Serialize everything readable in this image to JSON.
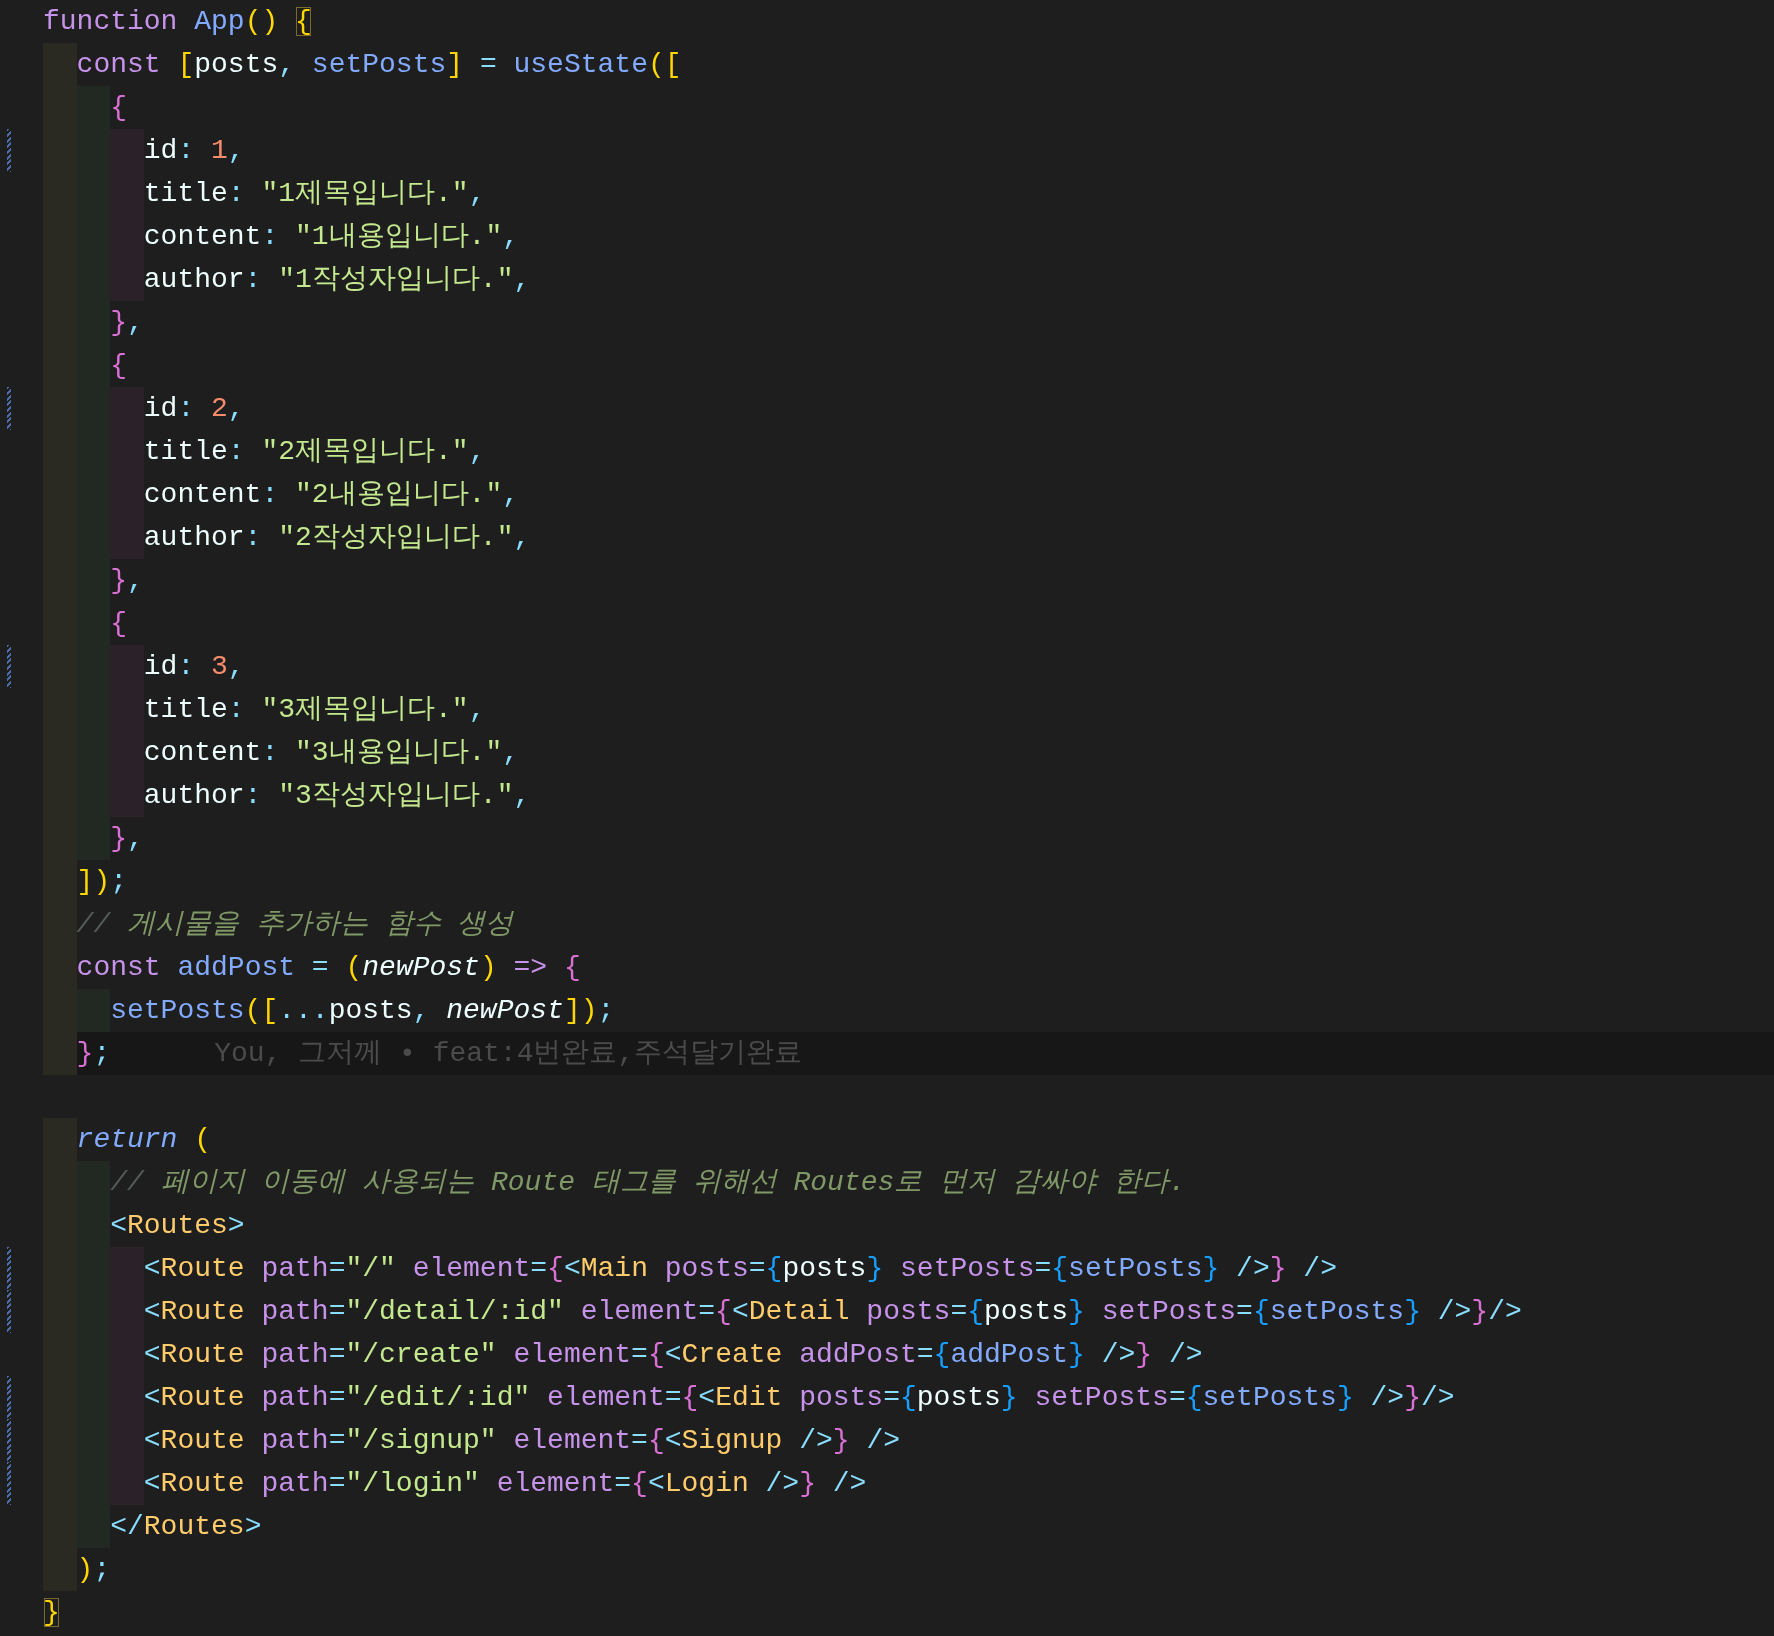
{
  "editor": {
    "lines": [
      {
        "modified": false,
        "current": false,
        "tokens": [
          {
            "text": "function ",
            "kind": "keyword"
          },
          {
            "text": "App",
            "kind": "function"
          },
          {
            "text": "() ",
            "kind": "bracket1"
          },
          {
            "text": "{",
            "kind": "bracket1-match"
          }
        ],
        "children": [
          {
            "modified": false,
            "current": false,
            "tokens": [
              {
                "text": "const ",
                "kind": "keyword"
              },
              {
                "text": "[",
                "kind": "bracket1"
              },
              {
                "text": "posts",
                "kind": "plain"
              },
              {
                "text": ", ",
                "kind": "punct"
              },
              {
                "text": "setPosts",
                "kind": "function"
              },
              {
                "text": "]",
                "kind": "bracket1"
              },
              {
                "text": " = ",
                "kind": "punct"
              },
              {
                "text": "useState",
                "kind": "function"
              },
              {
                "text": "([",
                "kind": "bracket1"
              }
            ],
            "children": [
              {
                "modified": false,
                "current": false,
                "tokens": [
                  {
                    "text": "{",
                    "kind": "bracket2"
                  }
                ],
                "children": [
                  {
                    "modified": true,
                    "current": false,
                    "tokens": [
                      {
                        "text": "id",
                        "kind": "plain"
                      },
                      {
                        "text": ": ",
                        "kind": "punct"
                      },
                      {
                        "text": "1",
                        "kind": "number"
                      },
                      {
                        "text": ",",
                        "kind": "punct"
                      }
                    ]
                  },
                  {
                    "modified": false,
                    "current": false,
                    "tokens": [
                      {
                        "text": "title",
                        "kind": "plain"
                      },
                      {
                        "text": ": ",
                        "kind": "punct"
                      },
                      {
                        "text": "\"1제목입니다.\"",
                        "kind": "string"
                      },
                      {
                        "text": ",",
                        "kind": "punct"
                      }
                    ]
                  },
                  {
                    "modified": false,
                    "current": false,
                    "tokens": [
                      {
                        "text": "content",
                        "kind": "plain"
                      },
                      {
                        "text": ": ",
                        "kind": "punct"
                      },
                      {
                        "text": "\"1내용입니다.\"",
                        "kind": "string"
                      },
                      {
                        "text": ",",
                        "kind": "punct"
                      }
                    ]
                  },
                  {
                    "modified": false,
                    "current": false,
                    "tokens": [
                      {
                        "text": "author",
                        "kind": "plain"
                      },
                      {
                        "text": ": ",
                        "kind": "punct"
                      },
                      {
                        "text": "\"1작성자입니다.\"",
                        "kind": "string"
                      },
                      {
                        "text": ",",
                        "kind": "punct"
                      }
                    ]
                  }
                ]
              },
              {
                "modified": false,
                "current": false,
                "tokens": [
                  {
                    "text": "}",
                    "kind": "bracket2"
                  },
                  {
                    "text": ",",
                    "kind": "punct"
                  }
                ]
              },
              {
                "modified": false,
                "current": false,
                "tokens": [
                  {
                    "text": "{",
                    "kind": "bracket2"
                  }
                ],
                "children": [
                  {
                    "modified": true,
                    "current": false,
                    "tokens": [
                      {
                        "text": "id",
                        "kind": "plain"
                      },
                      {
                        "text": ": ",
                        "kind": "punct"
                      },
                      {
                        "text": "2",
                        "kind": "number"
                      },
                      {
                        "text": ",",
                        "kind": "punct"
                      }
                    ]
                  },
                  {
                    "modified": false,
                    "current": false,
                    "tokens": [
                      {
                        "text": "title",
                        "kind": "plain"
                      },
                      {
                        "text": ": ",
                        "kind": "punct"
                      },
                      {
                        "text": "\"2제목입니다.\"",
                        "kind": "string"
                      },
                      {
                        "text": ",",
                        "kind": "punct"
                      }
                    ]
                  },
                  {
                    "modified": false,
                    "current": false,
                    "tokens": [
                      {
                        "text": "content",
                        "kind": "plain"
                      },
                      {
                        "text": ": ",
                        "kind": "punct"
                      },
                      {
                        "text": "\"2내용입니다.\"",
                        "kind": "string"
                      },
                      {
                        "text": ",",
                        "kind": "punct"
                      }
                    ]
                  },
                  {
                    "modified": false,
                    "current": false,
                    "tokens": [
                      {
                        "text": "author",
                        "kind": "plain"
                      },
                      {
                        "text": ": ",
                        "kind": "punct"
                      },
                      {
                        "text": "\"2작성자입니다.\"",
                        "kind": "string"
                      },
                      {
                        "text": ",",
                        "kind": "punct"
                      }
                    ]
                  }
                ]
              },
              {
                "modified": false,
                "current": false,
                "tokens": [
                  {
                    "text": "}",
                    "kind": "bracket2"
                  },
                  {
                    "text": ",",
                    "kind": "punct"
                  }
                ]
              },
              {
                "modified": false,
                "current": false,
                "tokens": [
                  {
                    "text": "{",
                    "kind": "bracket2"
                  }
                ],
                "children": [
                  {
                    "modified": true,
                    "current": false,
                    "tokens": [
                      {
                        "text": "id",
                        "kind": "plain"
                      },
                      {
                        "text": ": ",
                        "kind": "punct"
                      },
                      {
                        "text": "3",
                        "kind": "number"
                      },
                      {
                        "text": ",",
                        "kind": "punct"
                      }
                    ]
                  },
                  {
                    "modified": false,
                    "current": false,
                    "tokens": [
                      {
                        "text": "title",
                        "kind": "plain"
                      },
                      {
                        "text": ": ",
                        "kind": "punct"
                      },
                      {
                        "text": "\"3제목입니다.\"",
                        "kind": "string"
                      },
                      {
                        "text": ",",
                        "kind": "punct"
                      }
                    ]
                  },
                  {
                    "modified": false,
                    "current": false,
                    "tokens": [
                      {
                        "text": "content",
                        "kind": "plain"
                      },
                      {
                        "text": ": ",
                        "kind": "punct"
                      },
                      {
                        "text": "\"3내용입니다.\"",
                        "kind": "string"
                      },
                      {
                        "text": ",",
                        "kind": "punct"
                      }
                    ]
                  },
                  {
                    "modified": false,
                    "current": false,
                    "tokens": [
                      {
                        "text": "author",
                        "kind": "plain"
                      },
                      {
                        "text": ": ",
                        "kind": "punct"
                      },
                      {
                        "text": "\"3작성자입니다.\"",
                        "kind": "string"
                      },
                      {
                        "text": ",",
                        "kind": "punct"
                      }
                    ]
                  }
                ]
              },
              {
                "modified": false,
                "current": false,
                "tokens": [
                  {
                    "text": "}",
                    "kind": "bracket2"
                  },
                  {
                    "text": ",",
                    "kind": "punct"
                  }
                ]
              }
            ]
          },
          {
            "modified": false,
            "current": false,
            "tokens": [
              {
                "text": "])",
                "kind": "bracket1"
              },
              {
                "text": ";",
                "kind": "punct"
              }
            ]
          },
          {
            "modified": false,
            "current": false,
            "tokens": [
              {
                "text": "// ",
                "kind": "comment-mark"
              },
              {
                "text": "게시물을 추가하는 함수 생성",
                "kind": "comment"
              }
            ]
          },
          {
            "modified": false,
            "current": false,
            "tokens": [
              {
                "text": "const ",
                "kind": "keyword"
              },
              {
                "text": "addPost",
                "kind": "function"
              },
              {
                "text": " = ",
                "kind": "punct"
              },
              {
                "text": "(",
                "kind": "bracket1"
              },
              {
                "text": "newPost",
                "kind": "param"
              },
              {
                "text": ")",
                "kind": "bracket1"
              },
              {
                "text": " => ",
                "kind": "keyword"
              },
              {
                "text": "{",
                "kind": "bracket2"
              }
            ],
            "children": [
              {
                "modified": false,
                "current": false,
                "tokens": [
                  {
                    "text": "setPosts",
                    "kind": "function"
                  },
                  {
                    "text": "([",
                    "kind": "bracket1"
                  },
                  {
                    "text": "...",
                    "kind": "punct"
                  },
                  {
                    "text": "posts",
                    "kind": "plain"
                  },
                  {
                    "text": ", ",
                    "kind": "punct"
                  },
                  {
                    "text": "newPost",
                    "kind": "param"
                  },
                  {
                    "text": "])",
                    "kind": "bracket1"
                  },
                  {
                    "text": ";",
                    "kind": "punct"
                  }
                ]
              }
            ]
          },
          {
            "modified": false,
            "current": true,
            "tokens": [
              {
                "text": "}",
                "kind": "bracket2"
              },
              {
                "text": ";",
                "kind": "punct"
              }
            ],
            "blame": "You, 그저께 • feat:4번완료,주석달기완료"
          },
          {
            "modified": false,
            "current": false
          },
          {
            "modified": false,
            "current": false,
            "tokens": [
              {
                "text": "return ",
                "kind": "return"
              },
              {
                "text": "(",
                "kind": "bracket1"
              }
            ],
            "children": [
              {
                "modified": false,
                "current": false,
                "tokens": [
                  {
                    "text": "// ",
                    "kind": "comment-mark"
                  },
                  {
                    "text": "페이지 이동에 사용되는 Route 태그를 위해선 Routes로 먼저 감싸야 한다.",
                    "kind": "comment"
                  }
                ]
              },
              {
                "modified": false,
                "current": false,
                "tokens": [
                  {
                    "text": "<",
                    "kind": "punct"
                  },
                  {
                    "text": "Routes",
                    "kind": "tag"
                  },
                  {
                    "text": ">",
                    "kind": "punct"
                  }
                ],
                "children": [
                  {
                    "modified": true,
                    "current": false,
                    "tokens": [
                      {
                        "text": "<",
                        "kind": "punct"
                      },
                      {
                        "text": "Route",
                        "kind": "tag"
                      },
                      {
                        "text": " path",
                        "kind": "attribute"
                      },
                      {
                        "text": "=",
                        "kind": "punct"
                      },
                      {
                        "text": "\"/\"",
                        "kind": "string"
                      },
                      {
                        "text": " element",
                        "kind": "attribute"
                      },
                      {
                        "text": "=",
                        "kind": "punct"
                      },
                      {
                        "text": "{",
                        "kind": "bracket2"
                      },
                      {
                        "text": "<",
                        "kind": "punct"
                      },
                      {
                        "text": "Main",
                        "kind": "tag"
                      },
                      {
                        "text": " posts",
                        "kind": "attribute"
                      },
                      {
                        "text": "=",
                        "kind": "punct"
                      },
                      {
                        "text": "{",
                        "kind": "bracket3"
                      },
                      {
                        "text": "posts",
                        "kind": "plain"
                      },
                      {
                        "text": "}",
                        "kind": "bracket3"
                      },
                      {
                        "text": " setPosts",
                        "kind": "attribute"
                      },
                      {
                        "text": "=",
                        "kind": "punct"
                      },
                      {
                        "text": "{",
                        "kind": "bracket3"
                      },
                      {
                        "text": "setPosts",
                        "kind": "function"
                      },
                      {
                        "text": "}",
                        "kind": "bracket3"
                      },
                      {
                        "text": " />",
                        "kind": "punct"
                      },
                      {
                        "text": "}",
                        "kind": "bracket2"
                      },
                      {
                        "text": " />",
                        "kind": "punct"
                      }
                    ]
                  },
                  {
                    "modified": true,
                    "current": false,
                    "tokens": [
                      {
                        "text": "<",
                        "kind": "punct"
                      },
                      {
                        "text": "Route",
                        "kind": "tag"
                      },
                      {
                        "text": " path",
                        "kind": "attribute"
                      },
                      {
                        "text": "=",
                        "kind": "punct"
                      },
                      {
                        "text": "\"/detail/:id\"",
                        "kind": "string"
                      },
                      {
                        "text": " element",
                        "kind": "attribute"
                      },
                      {
                        "text": "=",
                        "kind": "punct"
                      },
                      {
                        "text": "{",
                        "kind": "bracket2"
                      },
                      {
                        "text": "<",
                        "kind": "punct"
                      },
                      {
                        "text": "Detail",
                        "kind": "tag"
                      },
                      {
                        "text": " posts",
                        "kind": "attribute"
                      },
                      {
                        "text": "=",
                        "kind": "punct"
                      },
                      {
                        "text": "{",
                        "kind": "bracket3"
                      },
                      {
                        "text": "posts",
                        "kind": "plain"
                      },
                      {
                        "text": "}",
                        "kind": "bracket3"
                      },
                      {
                        "text": " setPosts",
                        "kind": "attribute"
                      },
                      {
                        "text": "=",
                        "kind": "punct"
                      },
                      {
                        "text": "{",
                        "kind": "bracket3"
                      },
                      {
                        "text": "setPosts",
                        "kind": "function"
                      },
                      {
                        "text": "}",
                        "kind": "bracket3"
                      },
                      {
                        "text": " />",
                        "kind": "punct"
                      },
                      {
                        "text": "}",
                        "kind": "bracket2"
                      },
                      {
                        "text": "/>",
                        "kind": "punct"
                      }
                    ]
                  },
                  {
                    "modified": false,
                    "current": false,
                    "tokens": [
                      {
                        "text": "<",
                        "kind": "punct"
                      },
                      {
                        "text": "Route",
                        "kind": "tag"
                      },
                      {
                        "text": " path",
                        "kind": "attribute"
                      },
                      {
                        "text": "=",
                        "kind": "punct"
                      },
                      {
                        "text": "\"/create\"",
                        "kind": "string"
                      },
                      {
                        "text": " element",
                        "kind": "attribute"
                      },
                      {
                        "text": "=",
                        "kind": "punct"
                      },
                      {
                        "text": "{",
                        "kind": "bracket2"
                      },
                      {
                        "text": "<",
                        "kind": "punct"
                      },
                      {
                        "text": "Create",
                        "kind": "tag"
                      },
                      {
                        "text": " addPost",
                        "kind": "attribute"
                      },
                      {
                        "text": "=",
                        "kind": "punct"
                      },
                      {
                        "text": "{",
                        "kind": "bracket3"
                      },
                      {
                        "text": "addPost",
                        "kind": "function"
                      },
                      {
                        "text": "}",
                        "kind": "bracket3"
                      },
                      {
                        "text": " />",
                        "kind": "punct"
                      },
                      {
                        "text": "}",
                        "kind": "bracket2"
                      },
                      {
                        "text": " />",
                        "kind": "punct"
                      }
                    ]
                  },
                  {
                    "modified": true,
                    "current": false,
                    "tokens": [
                      {
                        "text": "<",
                        "kind": "punct"
                      },
                      {
                        "text": "Route",
                        "kind": "tag"
                      },
                      {
                        "text": " path",
                        "kind": "attribute"
                      },
                      {
                        "text": "=",
                        "kind": "punct"
                      },
                      {
                        "text": "\"/edit/:id\"",
                        "kind": "string"
                      },
                      {
                        "text": " element",
                        "kind": "attribute"
                      },
                      {
                        "text": "=",
                        "kind": "punct"
                      },
                      {
                        "text": "{",
                        "kind": "bracket2"
                      },
                      {
                        "text": "<",
                        "kind": "punct"
                      },
                      {
                        "text": "Edit",
                        "kind": "tag"
                      },
                      {
                        "text": " posts",
                        "kind": "attribute"
                      },
                      {
                        "text": "=",
                        "kind": "punct"
                      },
                      {
                        "text": "{",
                        "kind": "bracket3"
                      },
                      {
                        "text": "posts",
                        "kind": "plain"
                      },
                      {
                        "text": "}",
                        "kind": "bracket3"
                      },
                      {
                        "text": " setPosts",
                        "kind": "attribute"
                      },
                      {
                        "text": "=",
                        "kind": "punct"
                      },
                      {
                        "text": "{",
                        "kind": "bracket3"
                      },
                      {
                        "text": "setPosts",
                        "kind": "function"
                      },
                      {
                        "text": "}",
                        "kind": "bracket3"
                      },
                      {
                        "text": " />",
                        "kind": "punct"
                      },
                      {
                        "text": "}",
                        "kind": "bracket2"
                      },
                      {
                        "text": "/>",
                        "kind": "punct"
                      }
                    ]
                  },
                  {
                    "modified": true,
                    "current": false,
                    "tokens": [
                      {
                        "text": "<",
                        "kind": "punct"
                      },
                      {
                        "text": "Route",
                        "kind": "tag"
                      },
                      {
                        "text": " path",
                        "kind": "attribute"
                      },
                      {
                        "text": "=",
                        "kind": "punct"
                      },
                      {
                        "text": "\"/signup\"",
                        "kind": "string"
                      },
                      {
                        "text": " element",
                        "kind": "attribute"
                      },
                      {
                        "text": "=",
                        "kind": "punct"
                      },
                      {
                        "text": "{",
                        "kind": "bracket2"
                      },
                      {
                        "text": "<",
                        "kind": "punct"
                      },
                      {
                        "text": "Signup",
                        "kind": "tag"
                      },
                      {
                        "text": " />",
                        "kind": "punct"
                      },
                      {
                        "text": "}",
                        "kind": "bracket2"
                      },
                      {
                        "text": " />",
                        "kind": "punct"
                      }
                    ]
                  },
                  {
                    "modified": true,
                    "current": false,
                    "tokens": [
                      {
                        "text": "<",
                        "kind": "punct"
                      },
                      {
                        "text": "Route",
                        "kind": "tag"
                      },
                      {
                        "text": " path",
                        "kind": "attribute"
                      },
                      {
                        "text": "=",
                        "kind": "punct"
                      },
                      {
                        "text": "\"/login\"",
                        "kind": "string"
                      },
                      {
                        "text": " element",
                        "kind": "attribute"
                      },
                      {
                        "text": "=",
                        "kind": "punct"
                      },
                      {
                        "text": "{",
                        "kind": "bracket2"
                      },
                      {
                        "text": "<",
                        "kind": "punct"
                      },
                      {
                        "text": "Login",
                        "kind": "tag"
                      },
                      {
                        "text": " />",
                        "kind": "punct"
                      },
                      {
                        "text": "}",
                        "kind": "bracket2"
                      },
                      {
                        "text": " />",
                        "kind": "punct"
                      }
                    ]
                  }
                ]
              },
              {
                "modified": false,
                "current": false,
                "tokens": [
                  {
                    "text": "</",
                    "kind": "punct"
                  },
                  {
                    "text": "Routes",
                    "kind": "tag"
                  },
                  {
                    "text": ">",
                    "kind": "punct"
                  }
                ]
              }
            ]
          },
          {
            "modified": false,
            "current": false,
            "tokens": [
              {
                "text": ")",
                "kind": "bracket1"
              },
              {
                "text": ";",
                "kind": "punct"
              }
            ]
          }
        ]
      },
      {
        "modified": false,
        "current": false,
        "tokens": [
          {
            "text": "}",
            "kind": "bracket1-match"
          }
        ]
      }
    ]
  }
}
